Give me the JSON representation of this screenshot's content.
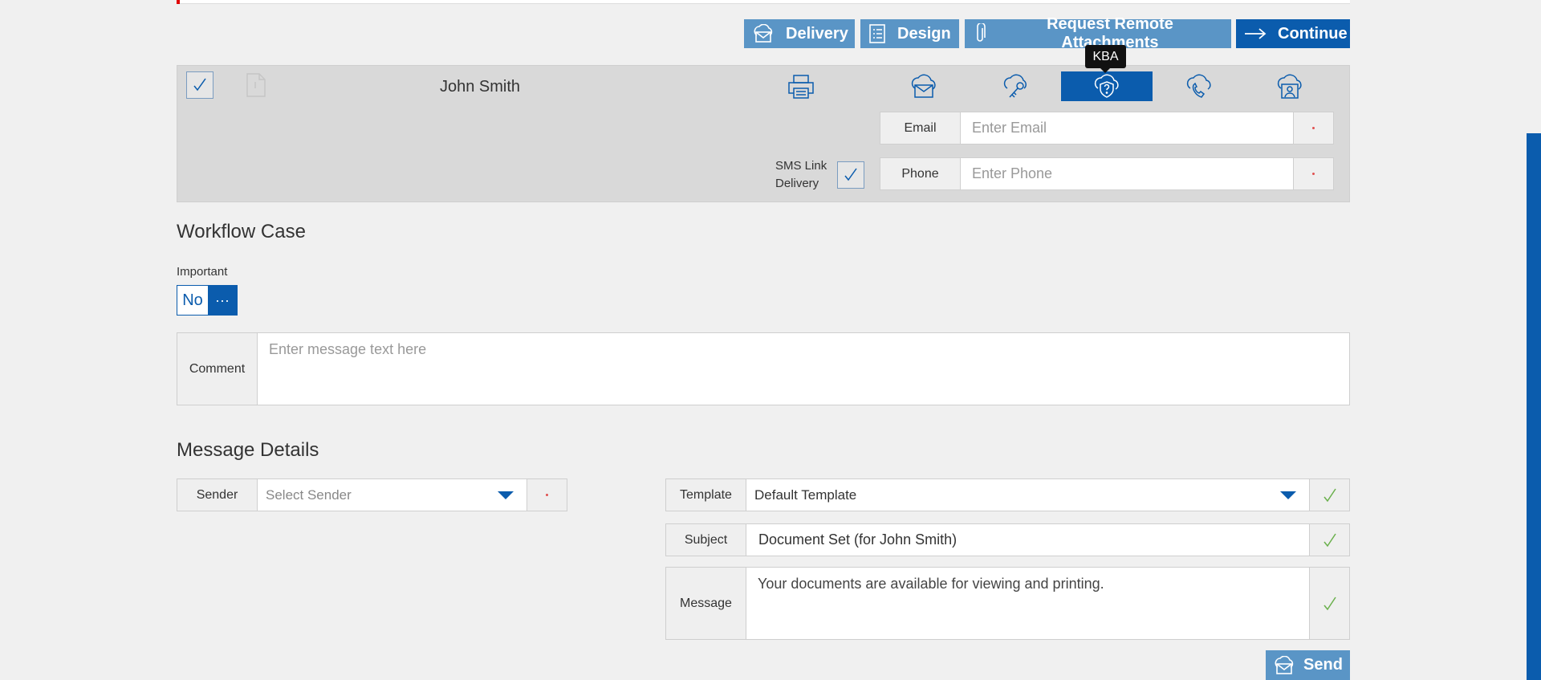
{
  "toolbar": {
    "delivery_label": "Delivery",
    "design_label": "Design",
    "request_attachments_label": "Request Remote Attachments",
    "continue_label": "Continue"
  },
  "recipient": {
    "name": "John Smith",
    "active_method_tooltip": "KBA",
    "email_label": "Email",
    "email_placeholder": "Enter Email",
    "phone_label": "Phone",
    "phone_placeholder": "Enter Phone",
    "sms_label_line1": "SMS Link",
    "sms_label_line2": "Delivery",
    "methods": [
      "print-icon",
      "cloud-mail-icon",
      "cloud-key-icon",
      "cloud-shield-question-icon",
      "cloud-phone-icon",
      "cloud-person-icon"
    ]
  },
  "workflow": {
    "title": "Workflow Case",
    "important_label": "Important",
    "important_value": "No",
    "more_label": "···",
    "comment_label": "Comment",
    "comment_placeholder": "Enter message text here"
  },
  "message": {
    "title": "Message Details",
    "sender_label": "Sender",
    "sender_placeholder": "Select Sender",
    "template_label": "Template",
    "template_value": "Default Template",
    "subject_label": "Subject",
    "subject_value": "Document Set (for John Smith)",
    "message_label": "Message",
    "message_value": "Your documents are available for viewing and printing.",
    "send_label": "Send"
  },
  "colors": {
    "primary": "#0b5cad",
    "secondary": "#5a95c6",
    "check_green": "#6ab04c",
    "required": "#e05050"
  }
}
